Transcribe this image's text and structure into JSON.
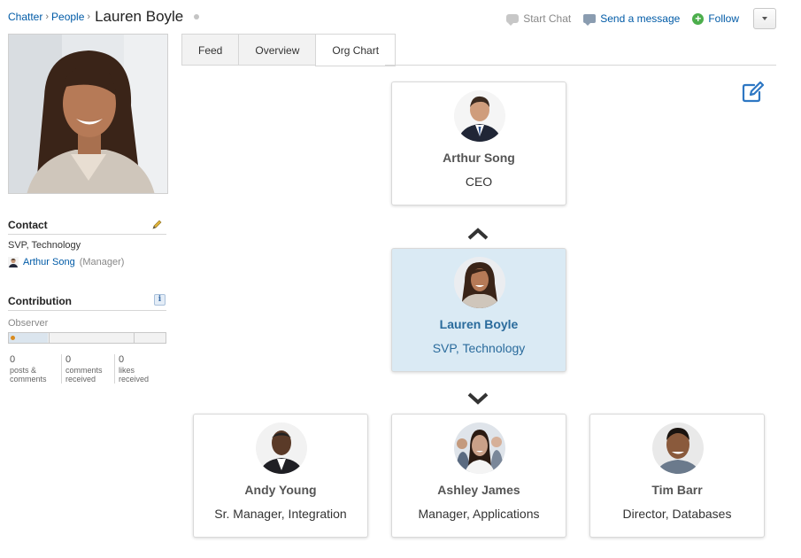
{
  "breadcrumb": {
    "root": "Chatter",
    "section": "People",
    "title": "Lauren Boyle"
  },
  "header_actions": {
    "start_chat": "Start Chat",
    "send_message": "Send a message",
    "follow": "Follow"
  },
  "tabs": [
    {
      "label": "Feed"
    },
    {
      "label": "Overview"
    },
    {
      "label": "Org Chart"
    }
  ],
  "contact": {
    "heading": "Contact",
    "title": "SVP, Technology",
    "manager_name": "Arthur Song",
    "manager_suffix": "(Manager)"
  },
  "contribution": {
    "heading": "Contribution",
    "info_icon_label": "i",
    "level": "Observer",
    "progress_fraction": 0.25,
    "stats": [
      {
        "value": "0",
        "line1": "posts &",
        "line2": "comments"
      },
      {
        "value": "0",
        "line1": "comments",
        "line2": "received"
      },
      {
        "value": "0",
        "line1": "likes",
        "line2": "received"
      }
    ]
  },
  "org_chart": {
    "manager": {
      "name": "Arthur Song",
      "role": "CEO"
    },
    "selected": {
      "name": "Lauren Boyle",
      "role": "SVP, Technology"
    },
    "reports": [
      {
        "name": "Andy Young",
        "role": "Sr. Manager, Integration"
      },
      {
        "name": "Ashley James",
        "role": "Manager, Applications"
      },
      {
        "name": "Tim Barr",
        "role": "Director, Databases"
      }
    ]
  },
  "colors": {
    "link": "#015ba7",
    "selected_card_bg": "#daeaf4",
    "selected_card_text": "#2a6b9c",
    "follow_green": "#4cae4c",
    "edit_icon_blue": "#2e77c3"
  },
  "icons": [
    "chat-icon",
    "message-icon",
    "follow-plus-icon",
    "dropdown-caret-icon",
    "pencil-icon",
    "info-icon",
    "edit-icon",
    "chevron-up-icon",
    "chevron-down-icon"
  ]
}
